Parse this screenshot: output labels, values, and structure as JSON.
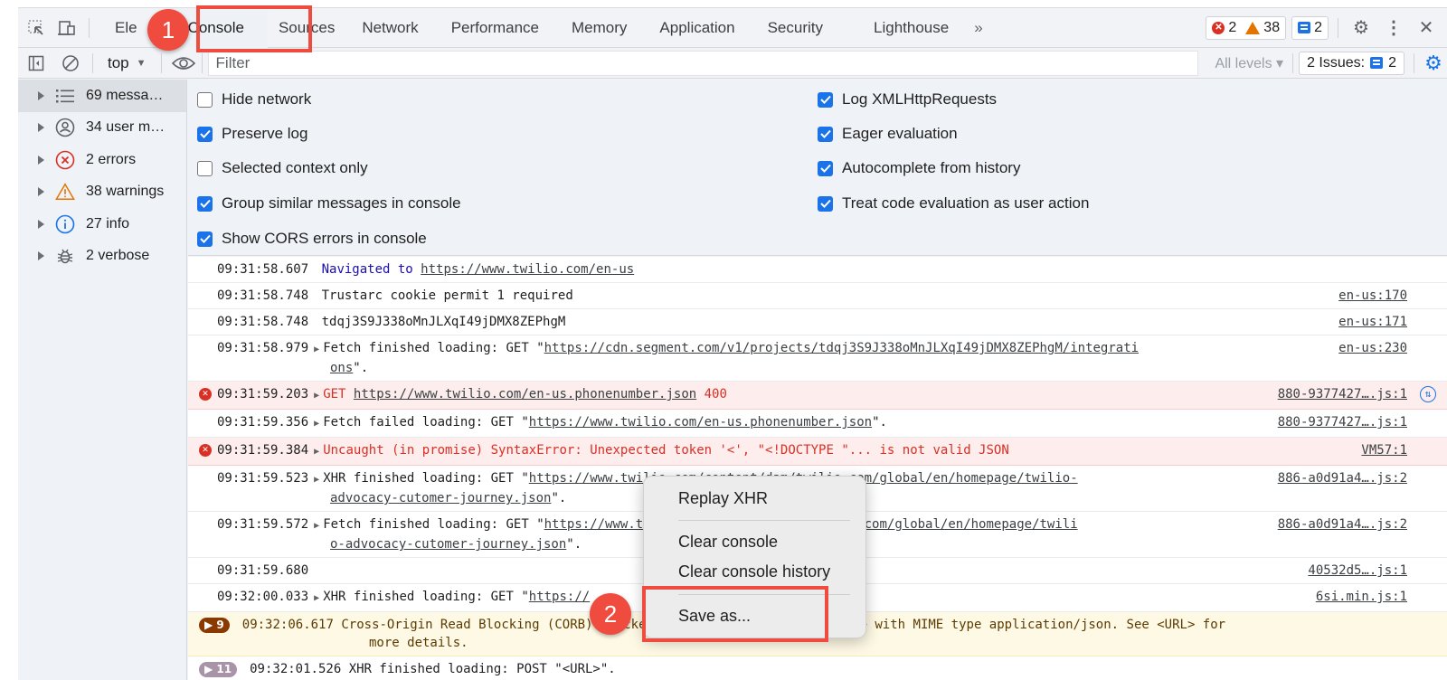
{
  "tabs": [
    {
      "label": "Elements",
      "display": "Ele",
      "active": false
    },
    {
      "label": "Console",
      "active": true
    },
    {
      "label": "Sources",
      "active": false
    },
    {
      "label": "Network",
      "active": false
    },
    {
      "label": "Performance",
      "active": false
    },
    {
      "label": "Memory",
      "active": false
    },
    {
      "label": "Application",
      "active": false
    },
    {
      "label": "Security",
      "active": false
    },
    {
      "label": "Lighthouse",
      "active": false
    }
  ],
  "tab_overflow": "»",
  "counts": {
    "errors": "2",
    "warnings": "38",
    "messages": "2"
  },
  "toolbar": {
    "context": "top",
    "filter_placeholder": "Filter",
    "levels": "All levels ▾",
    "issues_label": "2 Issues:",
    "issues_count": "2"
  },
  "sidebar": [
    {
      "label": "69 messa…",
      "icon": "list-icon",
      "selected": true
    },
    {
      "label": "34 user m…",
      "icon": "user-icon",
      "selected": false
    },
    {
      "label": "2 errors",
      "icon": "error-icon",
      "selected": false
    },
    {
      "label": "38 warnings",
      "icon": "warning-icon",
      "selected": false
    },
    {
      "label": "27 info",
      "icon": "info-icon",
      "selected": false
    },
    {
      "label": "2 verbose",
      "icon": "bug-icon",
      "selected": false
    }
  ],
  "settings_left": [
    {
      "label": "Hide network",
      "checked": false
    },
    {
      "label": "Preserve log",
      "checked": true
    },
    {
      "label": "Selected context only",
      "checked": false
    },
    {
      "label": "Group similar messages in console",
      "checked": true
    },
    {
      "label": "Show CORS errors in console",
      "checked": true
    }
  ],
  "settings_right": [
    {
      "label": "Log XMLHttpRequests",
      "checked": true
    },
    {
      "label": "Eager evaluation",
      "checked": true
    },
    {
      "label": "Autocomplete from history",
      "checked": true
    },
    {
      "label": "Treat code evaluation as user action",
      "checked": true
    }
  ],
  "log": [
    {
      "ts": "09:31:58.607",
      "pre": "Navigated to ",
      "url": "https://www.twilio.com/en-us",
      "post": "",
      "src": "",
      "level": "nav"
    },
    {
      "ts": "09:31:58.748",
      "pre": "Trustarc cookie permit 1 required",
      "url": "",
      "post": "",
      "src": "en-us:170",
      "level": "info"
    },
    {
      "ts": "09:31:58.748",
      "pre": "tdqj3S9J338oMnJLXqI49jDMX8ZEPhgM",
      "url": "",
      "post": "",
      "src": "en-us:171",
      "level": "info"
    },
    {
      "ts": "09:31:58.979",
      "pre": "Fetch finished loading: GET \"",
      "url": "https://cdn.segment.com/v1/projects/tdqj3S9J338oMnJLXqI49jDMX8ZEPhgM/integrati",
      "cont_url": "ons",
      "post": "\".",
      "src": "en-us:230",
      "level": "info",
      "expandable": true
    },
    {
      "ts": "09:31:59.203",
      "pre": "GET ",
      "url": "https://www.twilio.com/en-us.phonenumber.json",
      "post": " 400",
      "src": "880-9377427….js:1",
      "level": "error",
      "expandable": true
    },
    {
      "ts": "09:31:59.356",
      "pre": "Fetch failed loading: GET \"",
      "url": "https://www.twilio.com/en-us.phonenumber.json",
      "post": "\".",
      "src": "880-9377427….js:1",
      "level": "info",
      "expandable": true
    },
    {
      "ts": "09:31:59.384",
      "pre": "Uncaught (in promise) SyntaxError: Unexpected token '<', \"<!DOCTYPE \"... is not valid JSON",
      "url": "",
      "post": "",
      "src": "VM57:1",
      "level": "error",
      "expandable": true
    },
    {
      "ts": "09:31:59.523",
      "pre": "XHR finished loading: GET \"",
      "url": "https://www.twilio.com/content/dam/twilio-com/global/en/homepage/twilio-",
      "cont_url": "advocacy-cutomer-journey.json",
      "post": "\".",
      "src": "886-a0d91a4….js:2",
      "level": "info",
      "expandable": true
    },
    {
      "ts": "09:31:59.572",
      "pre": "Fetch finished loading: GET \"",
      "url": "https://www.twilio.com/content/dam/twilio-com/global/en/homepage/twili",
      "cont_url": "o-advocacy-cutomer-journey.json",
      "post": "\".",
      "src": "886-a0d91a4….js:2",
      "level": "info",
      "expandable": true
    },
    {
      "ts": "09:31:59.680",
      "pre": "",
      "url": "",
      "post": "",
      "src": "40532d5….js:1",
      "level": "info"
    },
    {
      "ts": "09:32:00.033",
      "pre": "XHR finished loading: GET \"",
      "url": "https://",
      "post": "",
      "src": "6si.min.js:1",
      "level": "info",
      "expandable": true
    },
    {
      "ts": "09:32:06.617",
      "pre": "Cross-Origin Read Blocking (CORB) blocked cross-origin response <URL> with MIME type application/json. See <URL> for",
      "cont_text": "more details.",
      "url": "",
      "post": "",
      "src": "",
      "level": "warn",
      "badge": "9"
    },
    {
      "ts": "09:32:01.526",
      "pre": "XHR finished loading: POST \"<URL>\".",
      "url": "",
      "post": "",
      "src": "",
      "level": "info",
      "badge": "11"
    }
  ],
  "context_menu": {
    "items": [
      "Replay XHR",
      "Clear console",
      "Clear console history",
      "Save as..."
    ]
  },
  "annotations": {
    "step1": "1",
    "step2": "2"
  },
  "colors": {
    "accent": "#1a73e8",
    "error": "#d93025",
    "warning": "#e37400",
    "annotation": "#ef4b3f"
  }
}
